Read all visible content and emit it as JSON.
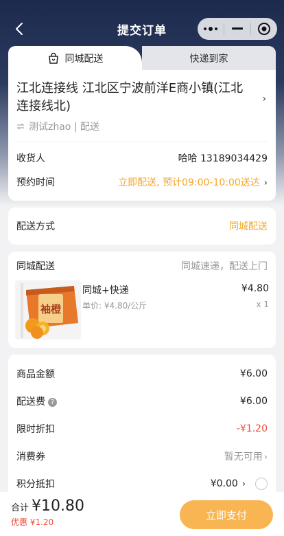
{
  "nav": {
    "title": "提交订单"
  },
  "tabs": [
    {
      "label": "同城配送",
      "active": true,
      "icon": "bag-icon"
    },
    {
      "label": "快递到家",
      "active": false
    }
  ],
  "address": {
    "line": "江北连接线 江北区宁波前洋E商小镇(江北连接线北)",
    "contact": "测试zhao | 配送",
    "receiver_label": "收货人",
    "receiver_value": "哈哈 13189034429",
    "schedule_label": "预约时间",
    "schedule_value": "立即配送, 预计09:00-10:00送达",
    "chevron": "›"
  },
  "delivery_method": {
    "label": "配送方式",
    "value": "同城配送"
  },
  "goods": {
    "section_label": "同城配送",
    "section_note": "同城速递，配送上门",
    "items": [
      {
        "name": "同城+快递",
        "unit_price": "单价: ¥4.80/公斤",
        "price": "¥4.80",
        "qty": "x 1",
        "box_text": "袖橙"
      }
    ]
  },
  "summary": {
    "goods_amount_label": "商品金额",
    "goods_amount": "¥6.00",
    "shipping_label": "配送费",
    "shipping_help": "?",
    "shipping": "¥6.00",
    "discount_label": "限时折扣",
    "discount": "-¥1.20",
    "coupon_label": "消费券",
    "coupon": "暂无可用",
    "points_label": "积分抵扣",
    "points": "¥0.00"
  },
  "footer": {
    "total_label": "合计",
    "total": "¥10.80",
    "discount": "优惠 ¥1.20",
    "pay_label": "立即支付"
  },
  "colors": {
    "accent_orange": "#f5a623",
    "pay_button": "#f9b552",
    "discount_red": "#f04b3a",
    "header_navy": "#1c2a4e"
  }
}
